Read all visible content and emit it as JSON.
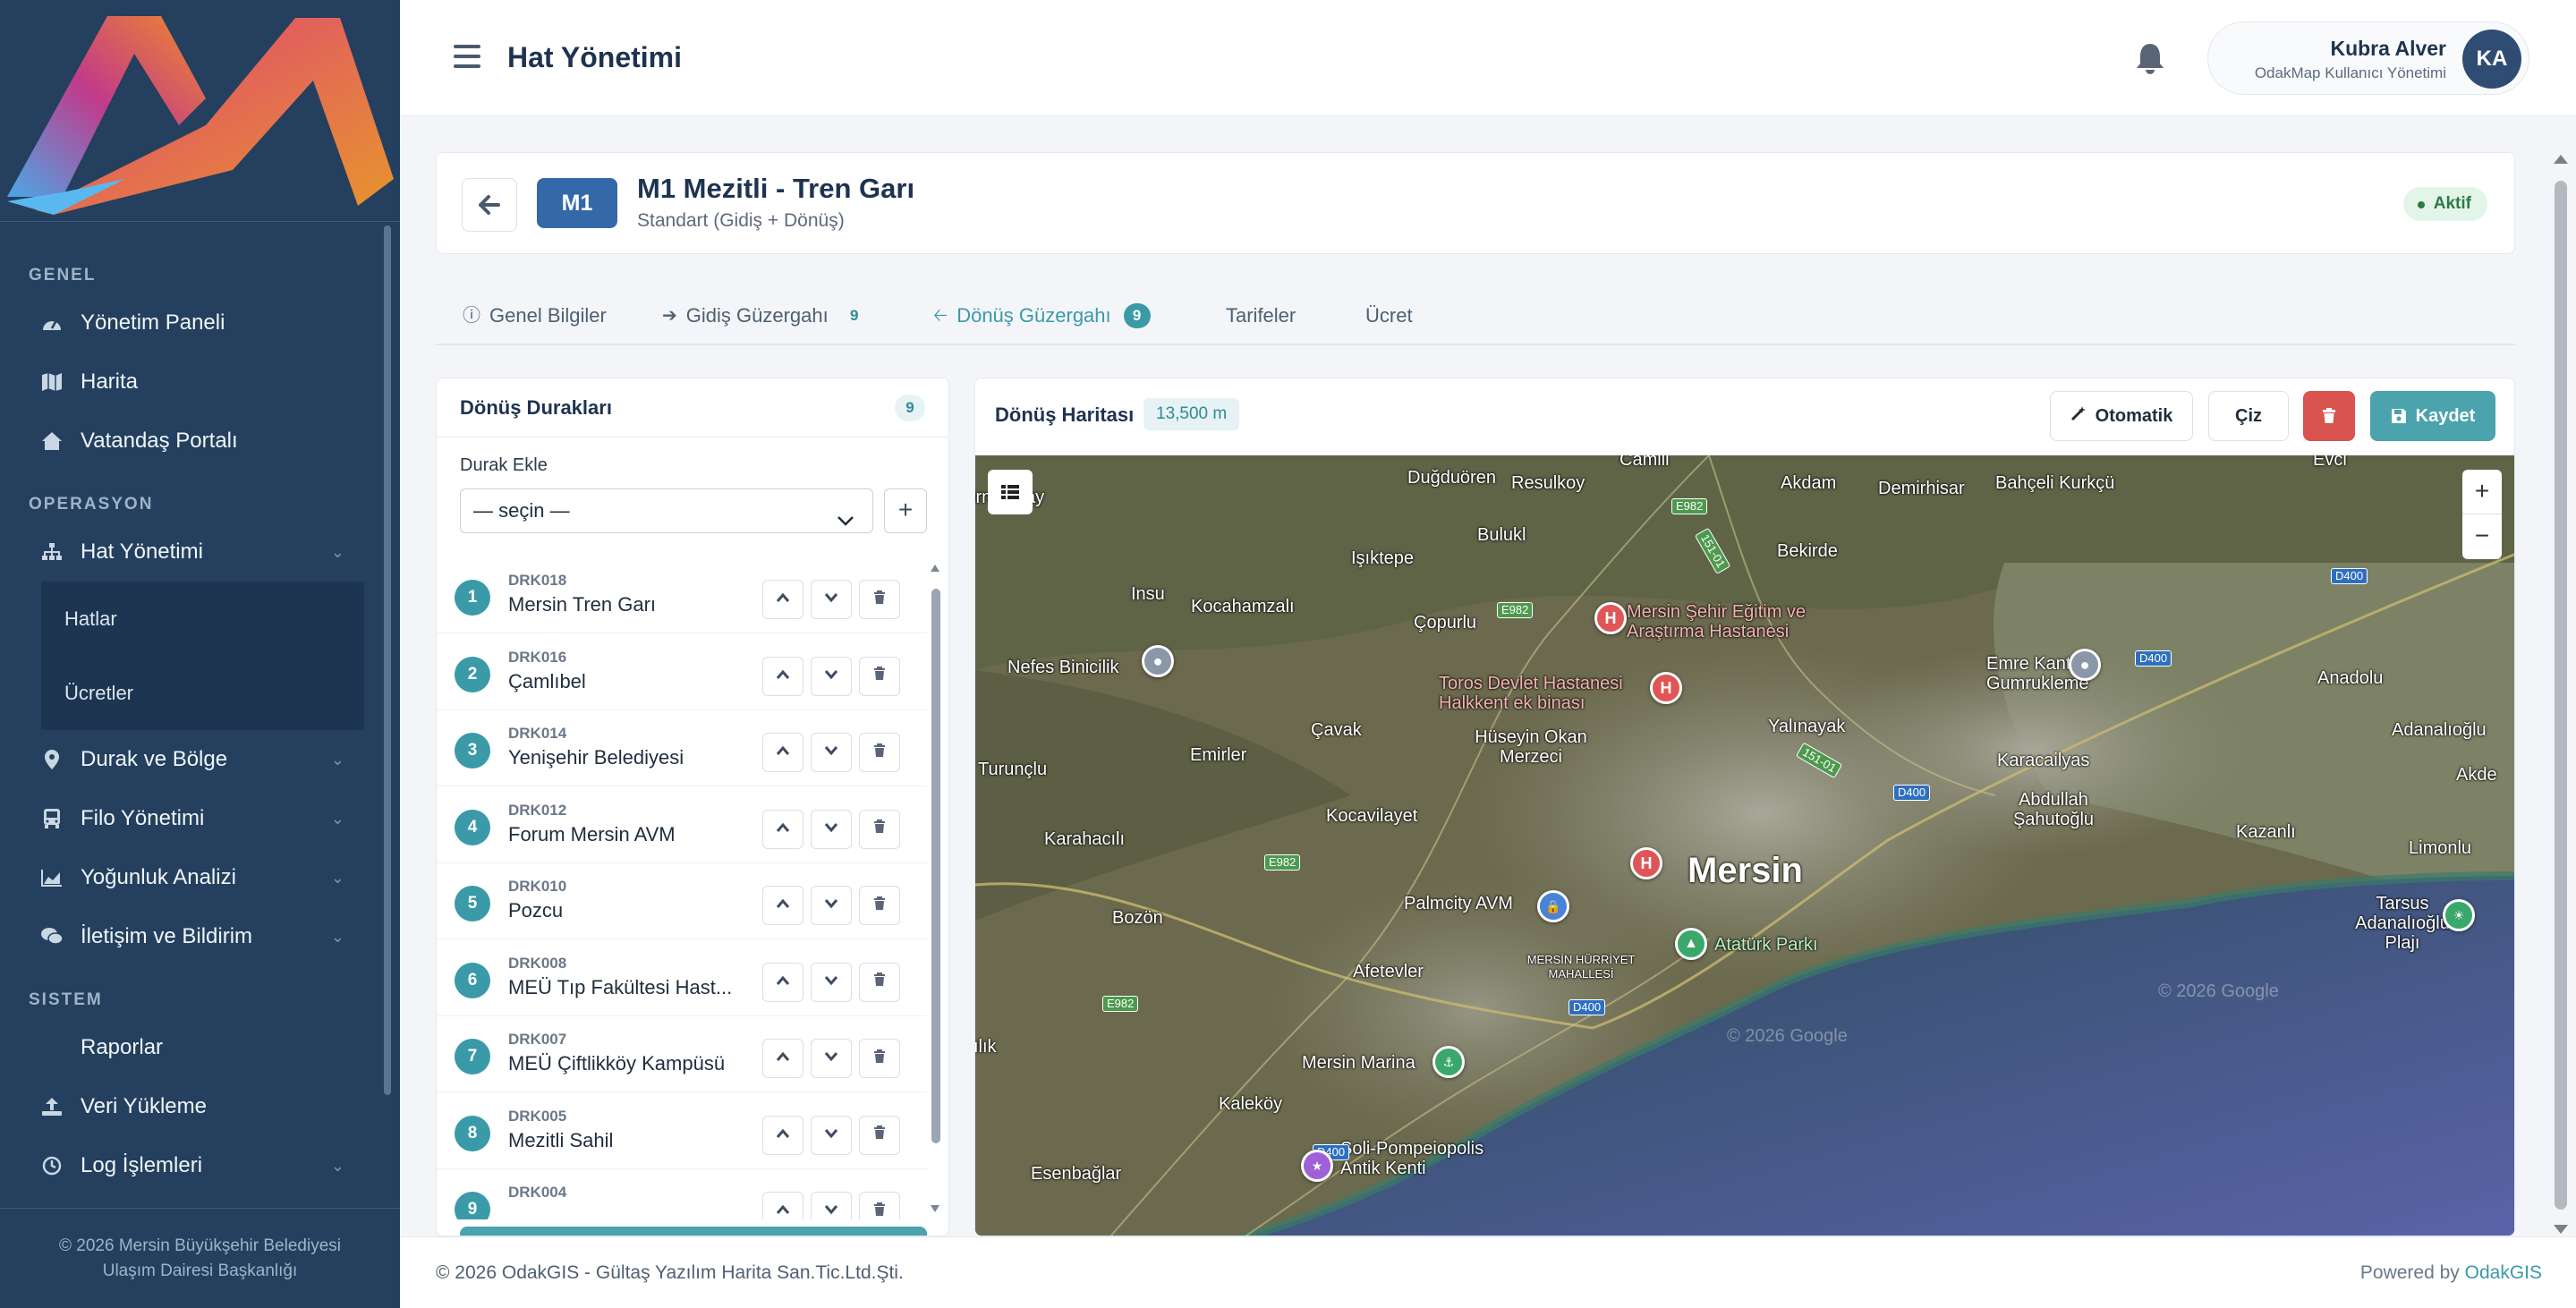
{
  "sidebar": {
    "sections": {
      "genel": "GENEL",
      "operasyon": "OPERASYON",
      "sistem": "SISTEM"
    },
    "items": {
      "dashboard": "Yönetim Paneli",
      "map": "Harita",
      "portal": "Vatandaş Portalı",
      "lines": "Hat Yönetimi",
      "stops": "Durak ve Bölge",
      "fleet": "Filo Yönetimi",
      "density": "Yoğunluk Analizi",
      "comms": "İletişim ve Bildirim",
      "reports": "Raporlar",
      "upload": "Veri Yükleme",
      "logs": "Log İşlemleri"
    },
    "sub": {
      "hatlar": "Hatlar",
      "ucretler": "Ücretler"
    },
    "footer": {
      "line1": "© 2026 Mersin Büyükşehir Belediyesi",
      "line2": "Ulaşım Dairesi Başkanlığı"
    }
  },
  "topbar": {
    "title": "Hat Yönetimi",
    "user_name": "Kubra Alver",
    "user_role": "OdakMap Kullanıcı Yönetimi",
    "avatar": "KA"
  },
  "route": {
    "code": "M1",
    "name": "M1 Mezitli - Tren Garı",
    "type": "Standart (Gidiş + Dönüş)",
    "status": "Aktif"
  },
  "tabs": {
    "general": "Genel Bilgiler",
    "outbound": "Gidiş Güzergahı",
    "outbound_count": "9",
    "return": "Dönüş Güzergahı",
    "return_count": "9",
    "tariffs": "Tarifeler",
    "fare": "Ücret"
  },
  "stops_panel": {
    "title": "Dönüş Durakları",
    "count": "9",
    "add_label": "Durak Ekle",
    "select_value": "— seçin —"
  },
  "stops": [
    {
      "num": "1",
      "code": "DRK018",
      "name": "Mersin Tren Garı"
    },
    {
      "num": "2",
      "code": "DRK016",
      "name": "Çamlıbel"
    },
    {
      "num": "3",
      "code": "DRK014",
      "name": "Yenişehir Belediyesi"
    },
    {
      "num": "4",
      "code": "DRK012",
      "name": "Forum Mersin AVM"
    },
    {
      "num": "5",
      "code": "DRK010",
      "name": "Pozcu"
    },
    {
      "num": "6",
      "code": "DRK008",
      "name": "MEÜ Tıp Fakültesi Hast..."
    },
    {
      "num": "7",
      "code": "DRK007",
      "name": "MEÜ Çiftlikköy Kampüsü"
    },
    {
      "num": "8",
      "code": "DRK005",
      "name": "Mezitli Sahil"
    },
    {
      "num": "9",
      "code": "DRK004",
      "name": ""
    }
  ],
  "map_panel": {
    "title": "Dönüş Haritası",
    "distance": "13,500 m",
    "btn_auto": "Otomatik",
    "btn_draw": "Çiz",
    "btn_save": "Kaydet"
  },
  "map": {
    "labels": {
      "city": "Mersin",
      "mercantil": "irmençay",
      "dugduoren": "Duğduören",
      "resulkoy": "Resulkoy",
      "camili": "Camili",
      "akdam": "Akdam",
      "demirhisar": "Demirhisar",
      "bahceli": "Bahçeli Kurkçü",
      "evci": "Evci",
      "bulukl": "Bulukl",
      "isiktepe": "Işıktepe",
      "bekirde": "Bekirde",
      "insu": "Insu",
      "kocahamzali": "Kocahamzalı",
      "copurlu": "Çopurlu",
      "hosp1": "Mersin Şehir Eğitim ve Araştırma Hastanesi",
      "nefes": "Nefes Binicilik",
      "emre": "Emre Kantar Gumrukleme",
      "anadolu": "Anadolu",
      "toros": "Toros Devlet Hastanesi Halkkent ek binası",
      "cavak": "Çavak",
      "huseyin": "Hüseyin Okan Merzeci",
      "yalinayak": "Yalınayak",
      "adanalioglu": "Adanalıoğlu",
      "emirler": "Emirler",
      "turunclu": "Turunçlu",
      "karacailyas": "Karacailyas",
      "akdeniz": "Akde",
      "kocavilayet": "Kocavilayet",
      "abdullah": "Abdullah Şahutoğlu",
      "karahacili": "Karahacılı",
      "kazanli": "Kazanlı",
      "limonlu": "Limonlu",
      "palmcity": "Palmcity AVM",
      "bozon": "Bozön",
      "ataturk": "Atatürk Parkı",
      "tarsus": "Tarsus Adanalıoğlu Plajı",
      "afetevler": "Afetevler",
      "hurriyet": "MERSİN HÜRRİYET MAHALLESİ",
      "ilik": "ılık",
      "marina": "Mersin Marina",
      "kalekoy": "Kaleköy",
      "soli": "Soli-Pompeiopolis Antik Kenti",
      "esenbaglar": "Esenbağlar",
      "copy1": "© 2026 Google",
      "copy2": "© 2026 Google"
    },
    "shields": {
      "e982a": "E982",
      "e982b": "E982",
      "e982c": "E982",
      "e982d": "E982",
      "d400a": "D400",
      "d400b": "D400",
      "d400c": "D400",
      "d400d": "D400",
      "d400e": "D400",
      "r151a": "151-01",
      "r151b": "151-01"
    }
  },
  "footer": {
    "left": "© 2026 OdakGIS - Gültaş Yazılım Harita San.Tic.Ltd.Şti.",
    "right_prefix": "Powered by ",
    "right_brand": "OdakGIS"
  }
}
